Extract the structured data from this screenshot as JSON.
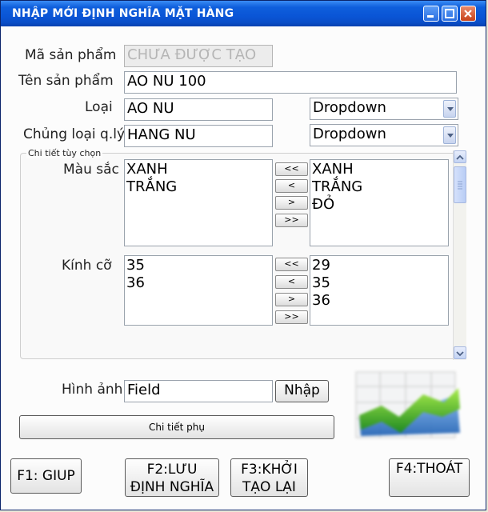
{
  "window": {
    "title": "NHẬP MỚI ĐỊNH NGHĨA MẶT HÀNG"
  },
  "form": {
    "ma_sp_label": "Mã sản phẩm",
    "ma_sp_value": "CHƯA ĐƯỢC TẠO",
    "ten_sp_label": "Tên sản phẩm",
    "ten_sp_value": "AO NU 100",
    "loai_label": "Loại",
    "loai_value": "AO NU",
    "loai_dropdown": "Dropdown",
    "chungloai_label": "Chủng loại q.lý",
    "chungloai_value": "HANG NU",
    "chungloai_dropdown": "Dropdown"
  },
  "details": {
    "group_title": "Chi tiết tùy chọn",
    "mausac_label": "Màu sắc",
    "mausac_left": [
      "XANH",
      "TRẮNG"
    ],
    "mausac_right": [
      "XANH",
      "TRẮNG",
      "ĐỎ"
    ],
    "kichco_label": "Kính cỡ",
    "kichco_left": [
      "35",
      "36"
    ],
    "kichco_right": [
      "29",
      "35",
      "36"
    ],
    "move_buttons": [
      "<<",
      "<",
      ">",
      ">>"
    ]
  },
  "image": {
    "label": "Hình ảnh",
    "value": "Field",
    "button": "Nhập"
  },
  "subdetail_button": "Chi tiết phụ",
  "footer": {
    "f1": "F1: GIUP",
    "f2_line1": "F2:LƯU",
    "f2_line2": "ĐỊNH NGHĨA",
    "f3_line1": "F3:KHỞI",
    "f3_line2": "TẠO LẠI",
    "f4": "F4:THOÁT"
  },
  "icons": [
    "minimize-icon",
    "maximize-icon",
    "close-icon",
    "chart-image-icon",
    "scroll-up-icon",
    "scroll-down-icon"
  ]
}
